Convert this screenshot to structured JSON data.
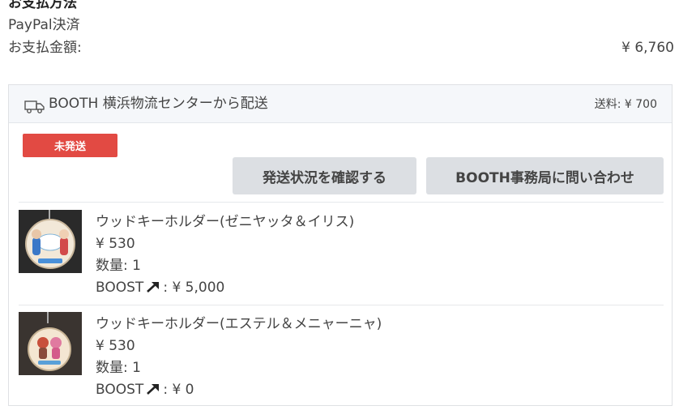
{
  "payment": {
    "title": "お支払方法",
    "method": "PayPal決済",
    "total_label": "お支払金額:",
    "total_value": "¥ 6,760"
  },
  "shipment": {
    "from": "BOOTH 横浜物流センターから配送",
    "fee": "送料: ¥ 700",
    "status": "未発送",
    "track_button": "発送状況を確認する",
    "contact_button": "BOOTH事務局に問い合わせ",
    "items": [
      {
        "title": "ウッドキーホルダー(ゼニヤッタ＆イリス)",
        "price": "¥ 530",
        "qty": "数量: 1",
        "boost_label": "BOOST",
        "boost_value": ": ¥ 5,000"
      },
      {
        "title": "ウッドキーホルダー(エステル＆メニャーニャ)",
        "price": "¥ 530",
        "qty": "数量: 1",
        "boost_label": "BOOST",
        "boost_value": ": ¥ 0"
      }
    ]
  },
  "colors": {
    "status_badge": "#e24a43",
    "button_bg": "#dcdfe3",
    "header_bg": "#f5f7fa"
  },
  "icons": [
    "truck-icon",
    "boost-arrow-icon"
  ]
}
